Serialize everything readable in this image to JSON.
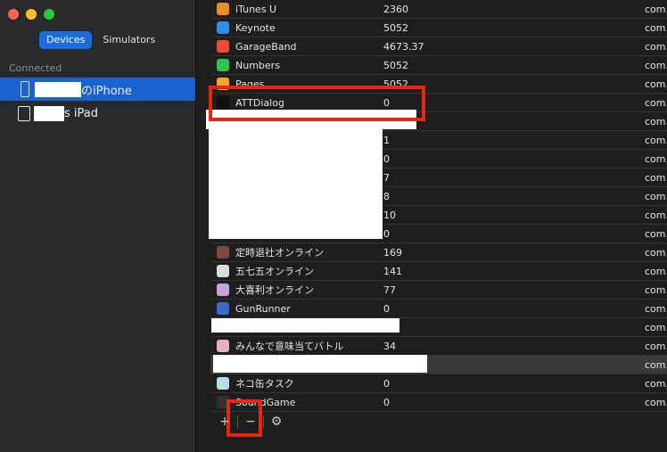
{
  "sidebar": {
    "tabs": [
      {
        "label": "Devices",
        "active": true
      },
      {
        "label": "Simulators",
        "active": false
      }
    ],
    "section_title": "Connected",
    "devices": [
      {
        "label": "のiPhone",
        "type": "iphone",
        "selected": true
      },
      {
        "label": "s iPad",
        "type": "ipad",
        "selected": false
      }
    ]
  },
  "apps": [
    {
      "name": "iTunes U",
      "value": "2360",
      "id": "com.a",
      "icon": "itunes-u-icon",
      "color": "#f08a24"
    },
    {
      "name": "Keynote",
      "value": "5052",
      "id": "com.a",
      "icon": "keynote-icon",
      "color": "#2f8ef0"
    },
    {
      "name": "GarageBand",
      "value": "4673.37",
      "id": "com.a",
      "icon": "garageband-icon",
      "color": "#f04a2f"
    },
    {
      "name": "Numbers",
      "value": "5052",
      "id": "com.a",
      "icon": "numbers-icon",
      "color": "#34c24a"
    },
    {
      "name": "Pages",
      "value": "5052",
      "id": "com.a",
      "icon": "pages-icon",
      "color": "#f5a623"
    },
    {
      "name": "ATTDialog",
      "value": "0",
      "id": "com.l",
      "icon": "attdialog-icon",
      "color": "#111111"
    },
    {
      "name": "",
      "value": "",
      "id": "com.f",
      "icon": "",
      "color": ""
    },
    {
      "name": "",
      "value": "1",
      "id": "com.s",
      "icon": "",
      "color": ""
    },
    {
      "name": "",
      "value": "0",
      "id": "com.s",
      "icon": "",
      "color": ""
    },
    {
      "name": "",
      "value": "7",
      "id": "com.s",
      "icon": "",
      "color": ""
    },
    {
      "name": "",
      "value": "8",
      "id": "com.s",
      "icon": "",
      "color": ""
    },
    {
      "name": "",
      "value": "10",
      "id": "com.s",
      "icon": "",
      "color": ""
    },
    {
      "name": "",
      "value": "0",
      "id": "com.s",
      "icon": "",
      "color": ""
    },
    {
      "name": "定時退社オンライン",
      "value": "169",
      "id": "com.s",
      "icon": "teiji-icon",
      "color": "#7a4a3a"
    },
    {
      "name": "五七五オンライン",
      "value": "141",
      "id": "com.s",
      "icon": "gosichigo-icon",
      "color": "#dddddd"
    },
    {
      "name": "大喜利オンライン",
      "value": "77",
      "id": "com.s",
      "icon": "oogiri-icon",
      "color": "#c9a0d8"
    },
    {
      "name": "GunRunner",
      "value": "0",
      "id": "com.s",
      "icon": "gunrunner-icon",
      "color": "#3a6ad0"
    },
    {
      "name": "",
      "value": "",
      "id": "com.s",
      "icon": "",
      "color": ""
    },
    {
      "name": "みんなで意味当てバトル",
      "value": "34",
      "id": "com.s",
      "icon": "minna-icon",
      "color": "#e8b0c0"
    },
    {
      "name": "",
      "value": "",
      "id": "com.s",
      "icon": "",
      "color": ""
    },
    {
      "name": "ネコ缶タスク",
      "value": "0",
      "id": "com.s",
      "icon": "nekokan-icon",
      "color": "#b0e0e8"
    },
    {
      "name": "SoundGame",
      "value": "0",
      "id": "com.s",
      "icon": "soundgame-icon",
      "color": "#333333"
    }
  ],
  "toolbar": {
    "add": "+",
    "remove": "−",
    "settings": "⚙"
  }
}
